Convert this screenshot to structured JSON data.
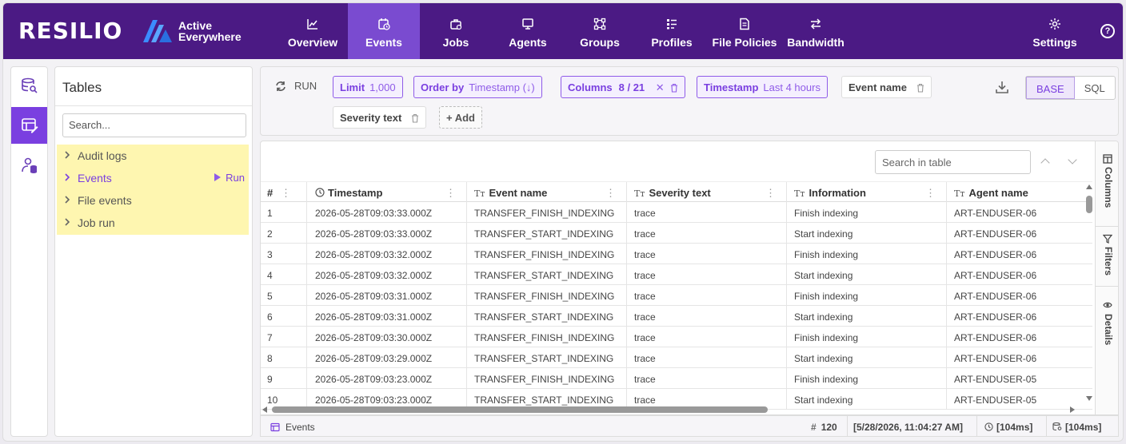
{
  "brand": {
    "logo_text": "RESILIO",
    "product_line1": "Active",
    "product_line2": "Everywhere",
    "accent": "#4b1a84",
    "active_accent": "#7a4bd0"
  },
  "nav": {
    "items": [
      {
        "label": "Overview",
        "icon": "chart-line-icon"
      },
      {
        "label": "Events",
        "icon": "calendar-clock-icon"
      },
      {
        "label": "Jobs",
        "icon": "briefcase-icon"
      },
      {
        "label": "Agents",
        "icon": "monitor-icon"
      },
      {
        "label": "Groups",
        "icon": "group-nodes-icon"
      },
      {
        "label": "Profiles",
        "icon": "profile-list-icon"
      },
      {
        "label": "File Policies",
        "icon": "file-policy-icon"
      },
      {
        "label": "Bandwidth",
        "icon": "arrows-exchange-icon"
      }
    ],
    "active_index": 1,
    "settings_label": "Settings",
    "help_glyph": "?"
  },
  "tables_panel": {
    "title": "Tables",
    "search_placeholder": "Search...",
    "items": [
      {
        "label": "Audit logs"
      },
      {
        "label": "Events",
        "run_label": "Run"
      },
      {
        "label": "File events"
      },
      {
        "label": "Job run"
      }
    ]
  },
  "query": {
    "run_label": "RUN",
    "limit": {
      "label": "Limit",
      "value": "1,000"
    },
    "order_by": {
      "label": "Order by",
      "value": "Timestamp (↓)"
    },
    "columns": {
      "label": "Columns",
      "value": "8 / 21"
    },
    "timestamp": {
      "label": "Timestamp",
      "value": "Last 4 hours"
    },
    "event_name_label": "Event name",
    "severity_label": "Severity text",
    "add_label": "+ Add",
    "mode_base": "BASE",
    "mode_sql": "SQL"
  },
  "grid": {
    "search_placeholder": "Search in table",
    "columns": [
      "#",
      "Timestamp",
      "Event name",
      "Severity text",
      "Information",
      "Agent name"
    ],
    "rows": [
      [
        "1",
        "2026-05-28T09:03:33.000Z",
        "TRANSFER_FINISH_INDEXING",
        "trace",
        "Finish indexing",
        "ART-ENDUSER-06"
      ],
      [
        "2",
        "2026-05-28T09:03:33.000Z",
        "TRANSFER_START_INDEXING",
        "trace",
        "Start indexing",
        "ART-ENDUSER-06"
      ],
      [
        "3",
        "2026-05-28T09:03:32.000Z",
        "TRANSFER_FINISH_INDEXING",
        "trace",
        "Finish indexing",
        "ART-ENDUSER-06"
      ],
      [
        "4",
        "2026-05-28T09:03:32.000Z",
        "TRANSFER_START_INDEXING",
        "trace",
        "Start indexing",
        "ART-ENDUSER-06"
      ],
      [
        "5",
        "2026-05-28T09:03:31.000Z",
        "TRANSFER_FINISH_INDEXING",
        "trace",
        "Finish indexing",
        "ART-ENDUSER-06"
      ],
      [
        "6",
        "2026-05-28T09:03:31.000Z",
        "TRANSFER_START_INDEXING",
        "trace",
        "Start indexing",
        "ART-ENDUSER-06"
      ],
      [
        "7",
        "2026-05-28T09:03:30.000Z",
        "TRANSFER_FINISH_INDEXING",
        "trace",
        "Finish indexing",
        "ART-ENDUSER-06"
      ],
      [
        "8",
        "2026-05-28T09:03:29.000Z",
        "TRANSFER_START_INDEXING",
        "trace",
        "Start indexing",
        "ART-ENDUSER-06"
      ],
      [
        "9",
        "2026-05-28T09:03:23.000Z",
        "TRANSFER_FINISH_INDEXING",
        "trace",
        "Finish indexing",
        "ART-ENDUSER-05"
      ],
      [
        "10",
        "2026-05-28T09:03:23.000Z",
        "TRANSFER_START_INDEXING",
        "trace",
        "Start indexing",
        "ART-ENDUSER-05"
      ]
    ],
    "side_tabs": [
      "Columns",
      "Filters",
      "Details"
    ]
  },
  "status": {
    "table_name": "Events",
    "row_count": "120",
    "fetched_at": "[5/28/2026, 11:04:27 AM]",
    "query_time": "[104ms]",
    "db_time": "[104ms]"
  }
}
